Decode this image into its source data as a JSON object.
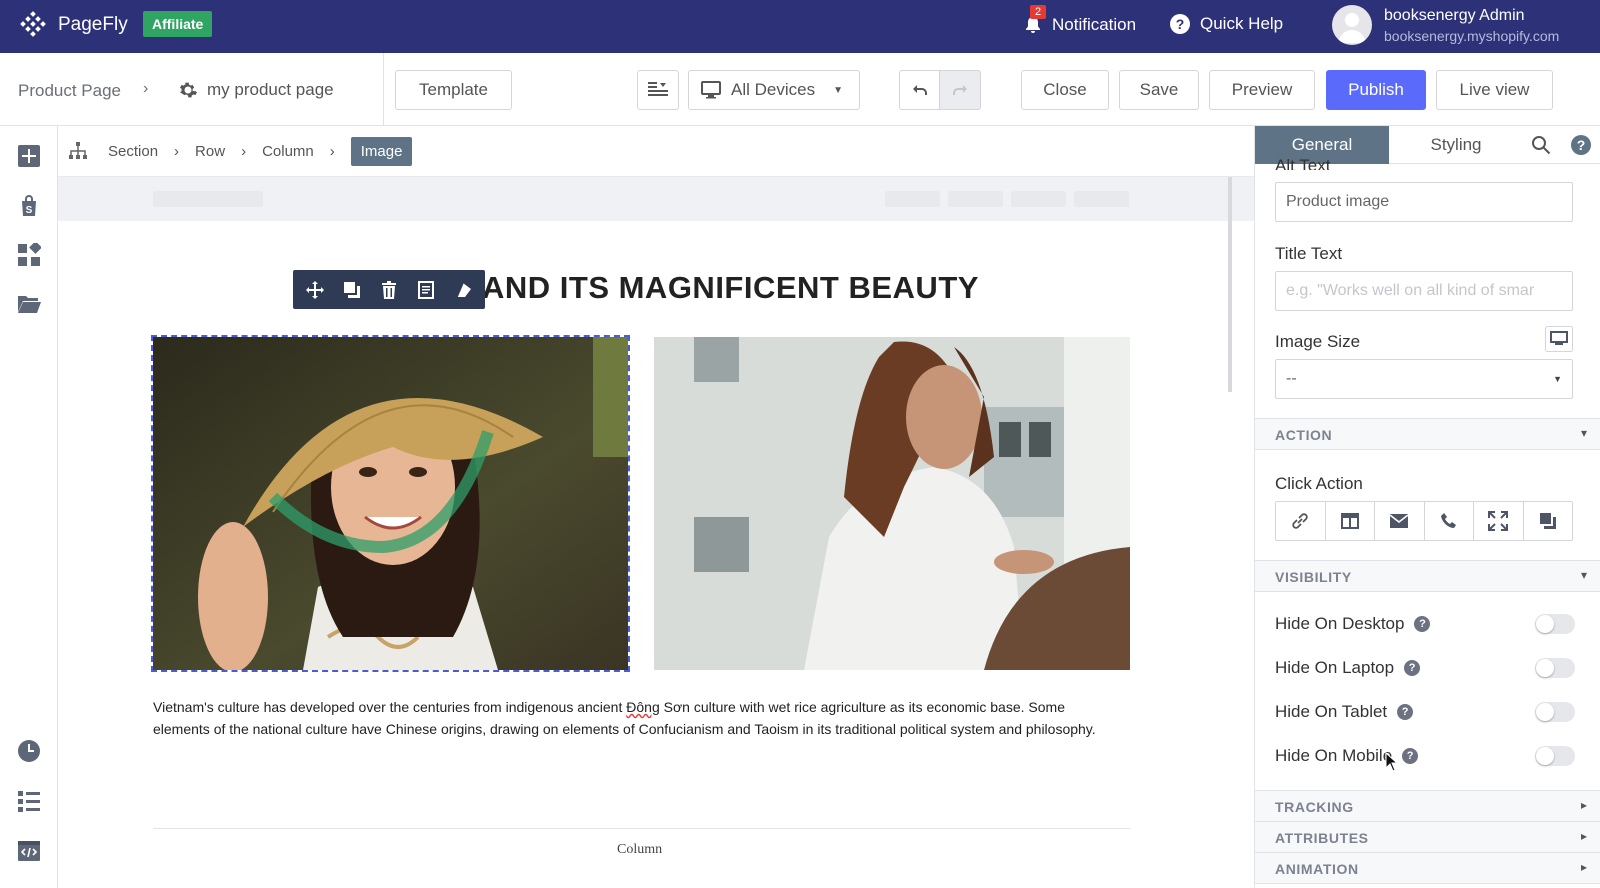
{
  "topbar": {
    "brand": "PageFly",
    "affiliate_badge": "Affiliate",
    "notification_count": "2",
    "notification_label": "Notification",
    "quick_help_label": "Quick Help",
    "user_name": "booksenergy Admin",
    "user_shop": "booksenergy.myshopify.com"
  },
  "toolbar": {
    "breadcrumb_root": "Product Page",
    "page_name": "my product page",
    "template_label": "Template",
    "devices_label": "All Devices",
    "close_label": "Close",
    "save_label": "Save",
    "preview_label": "Preview",
    "publish_label": "Publish",
    "liveview_label": "Live view"
  },
  "breadcrumb": {
    "items": [
      "Section",
      "Row",
      "Column"
    ],
    "active": "Image"
  },
  "canvas": {
    "heading": "AND ITS MAGNIFICENT BEAUTY",
    "desc_before": "Vietnam's culture has developed over the centuries from indigenous ancient ",
    "desc_spell": "Đông",
    "desc_after": " Sơn culture with wet rice agriculture as its economic base. Some elements of the national culture have Chinese origins, drawing on elements of Confucianism and Taoism in its traditional political system and philosophy.",
    "column_label": "Column"
  },
  "panel": {
    "tab_general": "General",
    "tab_styling": "Styling",
    "alt_text_label": "Alt Text",
    "alt_text_value": "Product image",
    "title_text_label": "Title Text",
    "title_text_placeholder": "e.g. \"Works well on all kind of smar",
    "image_size_label": "Image Size",
    "image_size_value": "--",
    "section_action": "ACTION",
    "click_action_label": "Click Action",
    "section_visibility": "VISIBILITY",
    "hide_desktop": "Hide On Desktop",
    "hide_laptop": "Hide On Laptop",
    "hide_tablet": "Hide On Tablet",
    "hide_mobile": "Hide On Mobile",
    "section_tracking": "TRACKING",
    "section_attributes": "ATTRIBUTES",
    "section_animation": "ANIMATION"
  },
  "colors": {
    "topbar": "#2c3178",
    "affiliate": "#2fa463",
    "primary": "#5a6bfb",
    "active_tab": "#5e7386"
  }
}
